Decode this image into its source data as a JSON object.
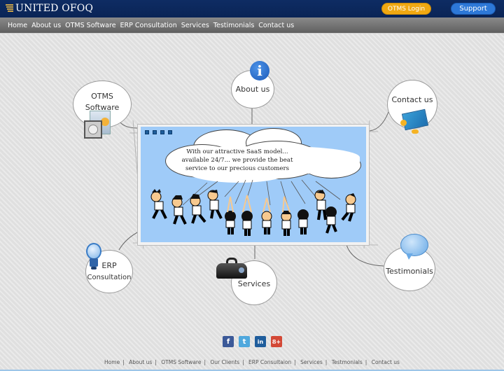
{
  "header": {
    "logo_text": "UNITED OFOQ",
    "otms_login_label": "OTMS Login",
    "support_label": "Support",
    "colors": {
      "topbar": "#0e2c63",
      "otms_button": "#f0a812",
      "support_button": "#2d78d8"
    }
  },
  "nav": {
    "items": [
      {
        "label": "Home"
      },
      {
        "label": "About us"
      },
      {
        "label": "OTMS Software"
      },
      {
        "label": "ERP Consultation"
      },
      {
        "label": "Services"
      },
      {
        "label": "Testimonials"
      },
      {
        "label": "Contact us"
      }
    ]
  },
  "hub": {
    "otms_line1": "OTMS",
    "otms_line2": "Software",
    "about": "About us",
    "contact": "Contact us",
    "erp_line1": "ERP",
    "erp_line2": "Consultation",
    "services": "Services",
    "testimonials": "Testimonials",
    "icons": {
      "otms": "software-box-icon",
      "about": "info-icon",
      "contact": "envelope-icon",
      "erp": "lightbulb-icon",
      "services": "toolbox-icon",
      "testimonials": "speech-bubble-icon"
    }
  },
  "banner": {
    "text_line1": "With our attractive SaaS model...",
    "text_line2": "available 24/7... we provide the beat",
    "text_line3": "service to our precious customers",
    "slide_count": 4,
    "background": "#9fcbf8"
  },
  "social": [
    {
      "name": "facebook",
      "glyph": "f",
      "color": "#3b5998"
    },
    {
      "name": "twitter",
      "glyph": "t",
      "color": "#4fa8dd"
    },
    {
      "name": "linkedin",
      "glyph": "in",
      "color": "#1f5d9c"
    },
    {
      "name": "google-plus",
      "glyph": "8+",
      "color": "#d34836"
    }
  ],
  "footer": {
    "links": [
      {
        "label": "Home"
      },
      {
        "label": "About us"
      },
      {
        "label": "OTMS Software"
      },
      {
        "label": "Our Clients"
      },
      {
        "label": "ERP Consultaion"
      },
      {
        "label": "Services"
      },
      {
        "label": "Testmonials"
      },
      {
        "label": "Contact us"
      }
    ],
    "separator": "|"
  }
}
